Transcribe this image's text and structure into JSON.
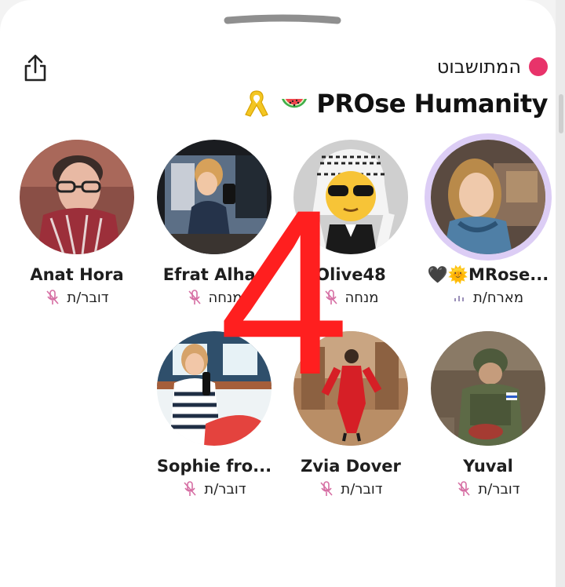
{
  "header": {
    "status_label": "המתושבוט",
    "status_color": "#e8336a",
    "title": "PROse Humanity",
    "title_icons": [
      "yellow-ribbon-icon",
      "watermelon-icon"
    ],
    "share_icon": "share-icon"
  },
  "speakers": [
    {
      "name": "Anat Hora",
      "role": "דובר/ת",
      "mic_icon": "mic-muted-icon",
      "avatar": "anat-hora-avatar"
    },
    {
      "name": "Efrat Alhas",
      "role": "מנחה",
      "mic_icon": "mic-muted-icon",
      "avatar": "efrat-alhas-avatar"
    },
    {
      "name": "Olive48",
      "role": "מנחה",
      "mic_icon": "mic-muted-icon",
      "avatar": "olive48-avatar"
    },
    {
      "name": "🖤🌞MRose...",
      "role": "מארח/ת",
      "mic_icon": "speaking-wave-icon",
      "avatar": "mrose-avatar"
    },
    {
      "name": "Sophie fro...",
      "role": "דובר/ת",
      "mic_icon": "mic-muted-icon",
      "avatar": "sophie-avatar"
    },
    {
      "name": "Zvia Dover",
      "role": "דובר/ת",
      "mic_icon": "mic-muted-icon",
      "avatar": "zvia-dover-avatar"
    },
    {
      "name": "Yuval",
      "role": "דובר/ת",
      "mic_icon": "mic-muted-icon",
      "avatar": "yuval-avatar"
    }
  ],
  "overlay": {
    "number": "4",
    "color": "#ff1f1f"
  }
}
